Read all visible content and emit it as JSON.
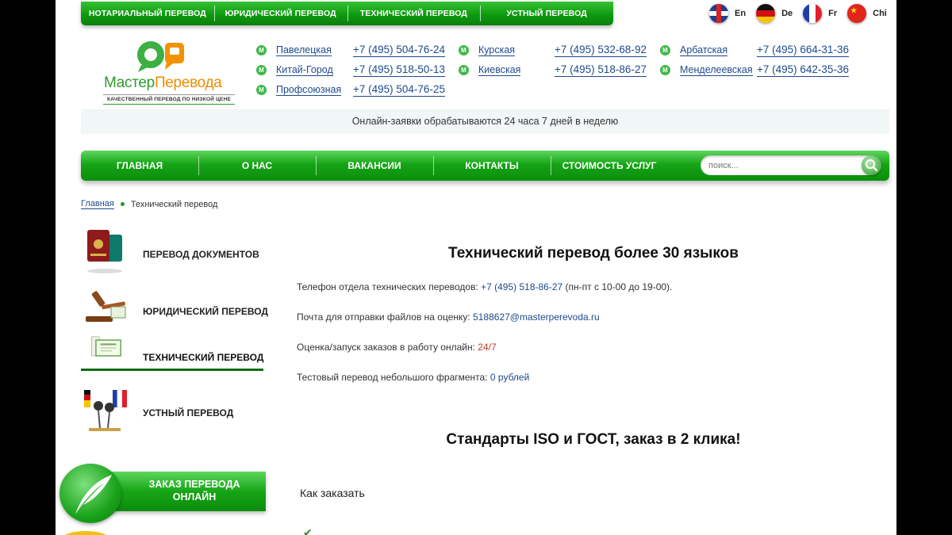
{
  "topbar": {
    "items": [
      "НОТАРИАЛЬНЫЙ ПЕРЕВОД",
      "ЮРИДИЧЕСКИЙ ПЕРЕВОД",
      "ТЕХНИЧЕСКИЙ ПЕРЕВОД",
      "УСТНЫЙ ПЕРЕВОД"
    ]
  },
  "languages": [
    {
      "code": "En",
      "icon": "flag-uk-icon"
    },
    {
      "code": "De",
      "icon": "flag-germany-icon"
    },
    {
      "code": "Fr",
      "icon": "flag-france-icon"
    },
    {
      "code": "Chi",
      "icon": "flag-china-icon"
    }
  ],
  "logo": {
    "name_part1": "Мастер",
    "name_part2": "Перевода",
    "tagline": "КАЧЕСТВЕННЫЙ ПЕРЕВОД ПО НИЗКОЙ ЦЕНЕ"
  },
  "contacts": {
    "columns": [
      {
        "stations": [
          "Павелецкая",
          "Китай-Город",
          "Профсоюзная"
        ],
        "phones": [
          "+7 (495) 504-76-24",
          "+7 (495) 518-50-13",
          "+7 (495) 504-76-25"
        ]
      },
      {
        "stations": [
          "Курская",
          "Киевская"
        ],
        "phones": [
          "+7 (495) 532-68-92",
          "+7 (495) 518-86-27"
        ]
      },
      {
        "stations": [
          "Арбатская",
          "Менделеевская"
        ],
        "phones": [
          "+7 (495) 664-31-36",
          "+7 (495) 642-35-36"
        ]
      }
    ],
    "metro_letter": "М"
  },
  "notice": "Онлайн-заявки обрабатываются 24 часа 7 дней в неделю",
  "nav": {
    "items": [
      "ГЛАВНАЯ",
      "О НАС",
      "ВАКАНСИИ",
      "КОНТАКТЫ",
      "СТОИМОСТЬ УСЛУГ"
    ],
    "search_placeholder": "поиск..."
  },
  "breadcrumb": {
    "home": "Главная",
    "current": "Технический перевод"
  },
  "sidebar": {
    "items": [
      {
        "label": "ПЕРЕВОД ДОКУМЕНТОВ",
        "icon": "passport-icon",
        "active": false
      },
      {
        "label": "ЮРИДИЧЕСКИЙ ПЕРЕВОД",
        "icon": "gavel-icon",
        "active": false
      },
      {
        "label": "ТЕХНИЧЕСКИЙ ПЕРЕВОД",
        "icon": "certificate-icon",
        "active": true
      },
      {
        "label": "УСТНЫЙ ПЕРЕВОД",
        "icon": "microphone-flags-icon",
        "active": false
      }
    ],
    "order_button": {
      "line1": "ЗАКАЗ ПЕРЕВОДА",
      "line2": "ОНЛАЙН",
      "icon": "feather-icon"
    }
  },
  "content": {
    "title": "Технический перевод более 30 языков",
    "phone_label": "Телефон отдела технических переводов: ",
    "phone": "+7 (495) 518-86-27",
    "phone_hours": " (пн-пт с 10-00 до 19-00).",
    "email_label": "Почта для отправки файлов на оценку: ",
    "email": "5188627@masterperevoda.ru",
    "online_label": "Оценка/запуск заказов в работу онлайн: ",
    "online_value": "24/7",
    "test_label": "Тестовый перевод небольшого фрагмента: ",
    "test_value": "0 рублей",
    "subtitle": "Стандарты ISO и ГОСТ, заказ в 2 клика!",
    "how_to_order": "Как заказать"
  },
  "colors": {
    "brand_green": "#16a516",
    "link_blue": "#1d4a8c",
    "accent_orange": "#f08c00"
  }
}
